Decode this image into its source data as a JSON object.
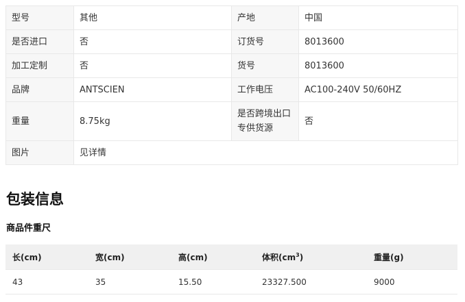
{
  "attributes": {
    "rows": [
      [
        {
          "k": "型号",
          "v": "其他"
        },
        {
          "k": "产地",
          "v": "中国"
        }
      ],
      [
        {
          "k": "是否进口",
          "v": "否"
        },
        {
          "k": "订货号",
          "v": "8013600"
        }
      ],
      [
        {
          "k": "加工定制",
          "v": "否"
        },
        {
          "k": "货号",
          "v": "8013600"
        }
      ],
      [
        {
          "k": "品牌",
          "v": "ANTSCIEN"
        },
        {
          "k": "工作电压",
          "v": "AC100-240V 50/60HZ"
        }
      ],
      [
        {
          "k": "重量",
          "v": "8.75kg"
        },
        {
          "k": "是否跨境出口专供货源",
          "v": "否"
        }
      ],
      [
        {
          "k": "图片",
          "v": "见详情"
        }
      ]
    ]
  },
  "packaging": {
    "title": "包装信息",
    "subtitle": "商品件重尺",
    "headers": {
      "length": "长(cm)",
      "width": "宽(cm)",
      "height": "高(cm)",
      "volume": "体积(cm",
      "volume_sup": "3",
      "volume_end": ")",
      "weight": "重量(g)"
    },
    "row": {
      "length": "43",
      "width": "35",
      "height": "15.50",
      "volume": "23327.500",
      "weight": "9000"
    }
  }
}
